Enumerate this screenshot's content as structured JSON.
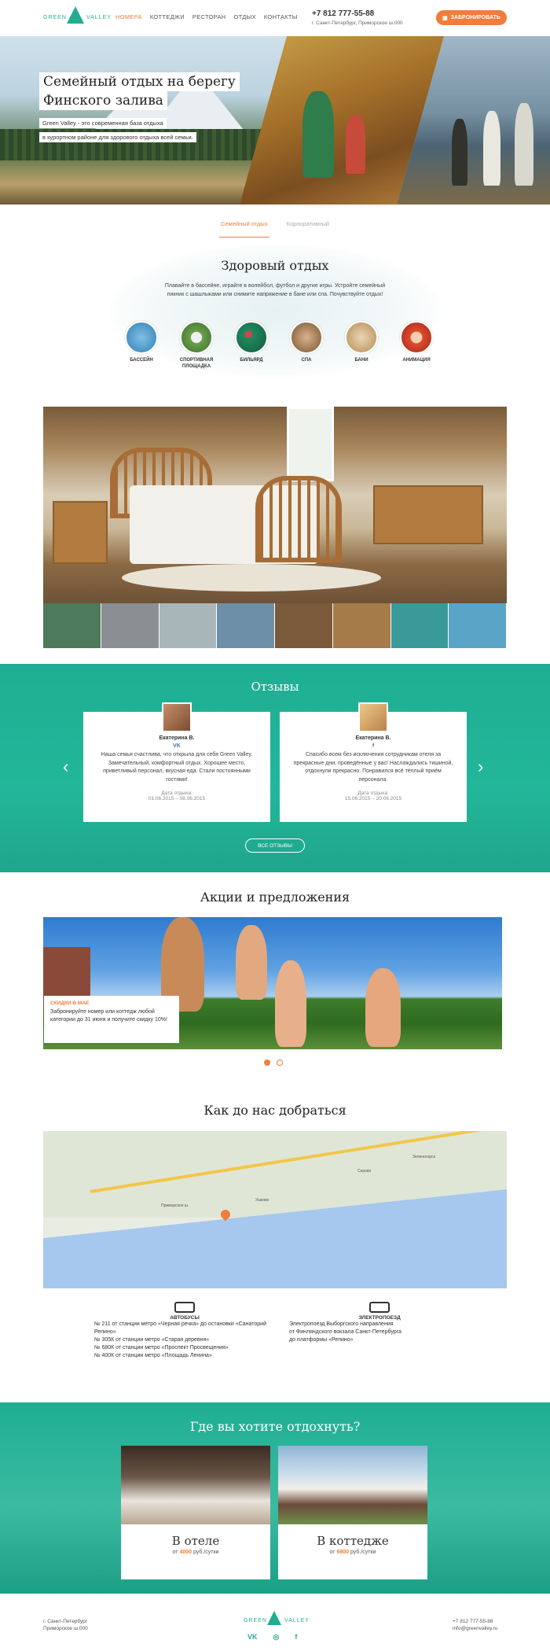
{
  "header": {
    "logo_left": "GREEN",
    "logo_right": "VALLEY",
    "nav": [
      "Номера",
      "Коттеджи",
      "Ресторан",
      "Отдых",
      "Контакты"
    ],
    "phone": "+7 812 777-55-88",
    "address": "г. Санкт-Петербург, Приморское ш.000",
    "book_label": "ЗАБРОНИРОВАТЬ"
  },
  "hero": {
    "title_line1": "Семейный отдых на  берегу",
    "title_line2": "Финского залива",
    "sub_line1": "Green Valley - это современная база отдыха",
    "sub_line2": "в курортном районе для здорового отдыха всей семьи."
  },
  "tabs": [
    "Семейный отдых",
    "Корпоративный"
  ],
  "healthy": {
    "title": "Здоровый отдых",
    "desc": "Плавайте в бассейне, играйте в волейбол, футбол и другие игры. Устройте семейный пикник с шашлыками или снимите напряжение в бане или спа. Почувствуйте отдых!",
    "items": [
      {
        "label": "Бассейн",
        "color": "#3b8fc4"
      },
      {
        "label": "Спортивная площадка",
        "color": "#4f8d3a"
      },
      {
        "label": "Бильярд",
        "color": "#2a8a6a"
      },
      {
        "label": "Спа",
        "color": "#7a5a3a"
      },
      {
        "label": "Бани",
        "color": "#c9a775"
      },
      {
        "label": "Анимация",
        "color": "#d9442b"
      }
    ]
  },
  "gallery": {
    "thumbs": [
      "#4d7a5a",
      "#8a8f93",
      "#a9b6b9",
      "#6e8fa8",
      "#7a5a3a",
      "#a57b4a",
      "#3a9a9a",
      "#5aa4c8"
    ]
  },
  "reviews": {
    "title": "Отзывы",
    "cards": [
      {
        "name": "Екатерина В.",
        "social": "VK",
        "text": "Наша семья счастлива, что открыла для себя Green Valley. Замечательный, комфортный отдых. Хорошее место, приветливый персонал, вкусная еда. Стали постоянными гостями!",
        "date_label": "Дата отдыха:",
        "date_value": "01.06.2015 – 08.06.2015"
      },
      {
        "name": "Екатерина В.",
        "social": "f",
        "text": "Спасибо всем без исключения сотрудникам отеля за прекрасные дни, проведённые у вас! Наслаждались тишиной, отдохнули прекрасно. Понравился всё тёплый приём персонала.",
        "date_label": "Дата отдыха:",
        "date_value": "15.06.2015 – 20.06.2015"
      }
    ],
    "all_label": "Все отзывы"
  },
  "offers": {
    "title": "Акции и предложения",
    "tag": "Скидки в мае",
    "text": "Забронируйте номер или коттедж любой категории до 31 июня и получите скидку 10%!"
  },
  "map": {
    "title": "Как до нас добраться",
    "labels": [
      "Приморское ш.",
      "Ушково",
      "Серово",
      "Зеленогорск"
    ]
  },
  "transport": {
    "bus": {
      "title": "Автобусы",
      "lines": [
        "№ 211 от станции метро «Черная речка» до остановки «Санаторий Репино»",
        "№ 305К от станции метро «Старая деревня»",
        "№ 680К от станции метро «Проспект Просвещения»",
        "№ 400К от станции метро «Площадь Ленина»"
      ]
    },
    "train": {
      "title": "Электропоезд",
      "lines": [
        "Электропоезд Выборгского направления",
        "от Финляндского вокзала Санкт-Петербурга",
        "до платформы «Репино»"
      ]
    }
  },
  "where": {
    "title": "Где вы хотите отдохнуть?",
    "cards": [
      {
        "name": "В отеле",
        "from": "от",
        "price": "4000",
        "unit": "руб./сутки"
      },
      {
        "name": "В коттедже",
        "from": "от",
        "price": "6800",
        "unit": "руб./сутки"
      }
    ]
  },
  "footer": {
    "addr1": "г. Санкт-Петербург",
    "addr2": "Приморское ш.000",
    "phone": "+7 812 777-55-88",
    "email": "info@greenvalley.ru",
    "social": [
      "VK",
      "◎",
      "f"
    ]
  }
}
